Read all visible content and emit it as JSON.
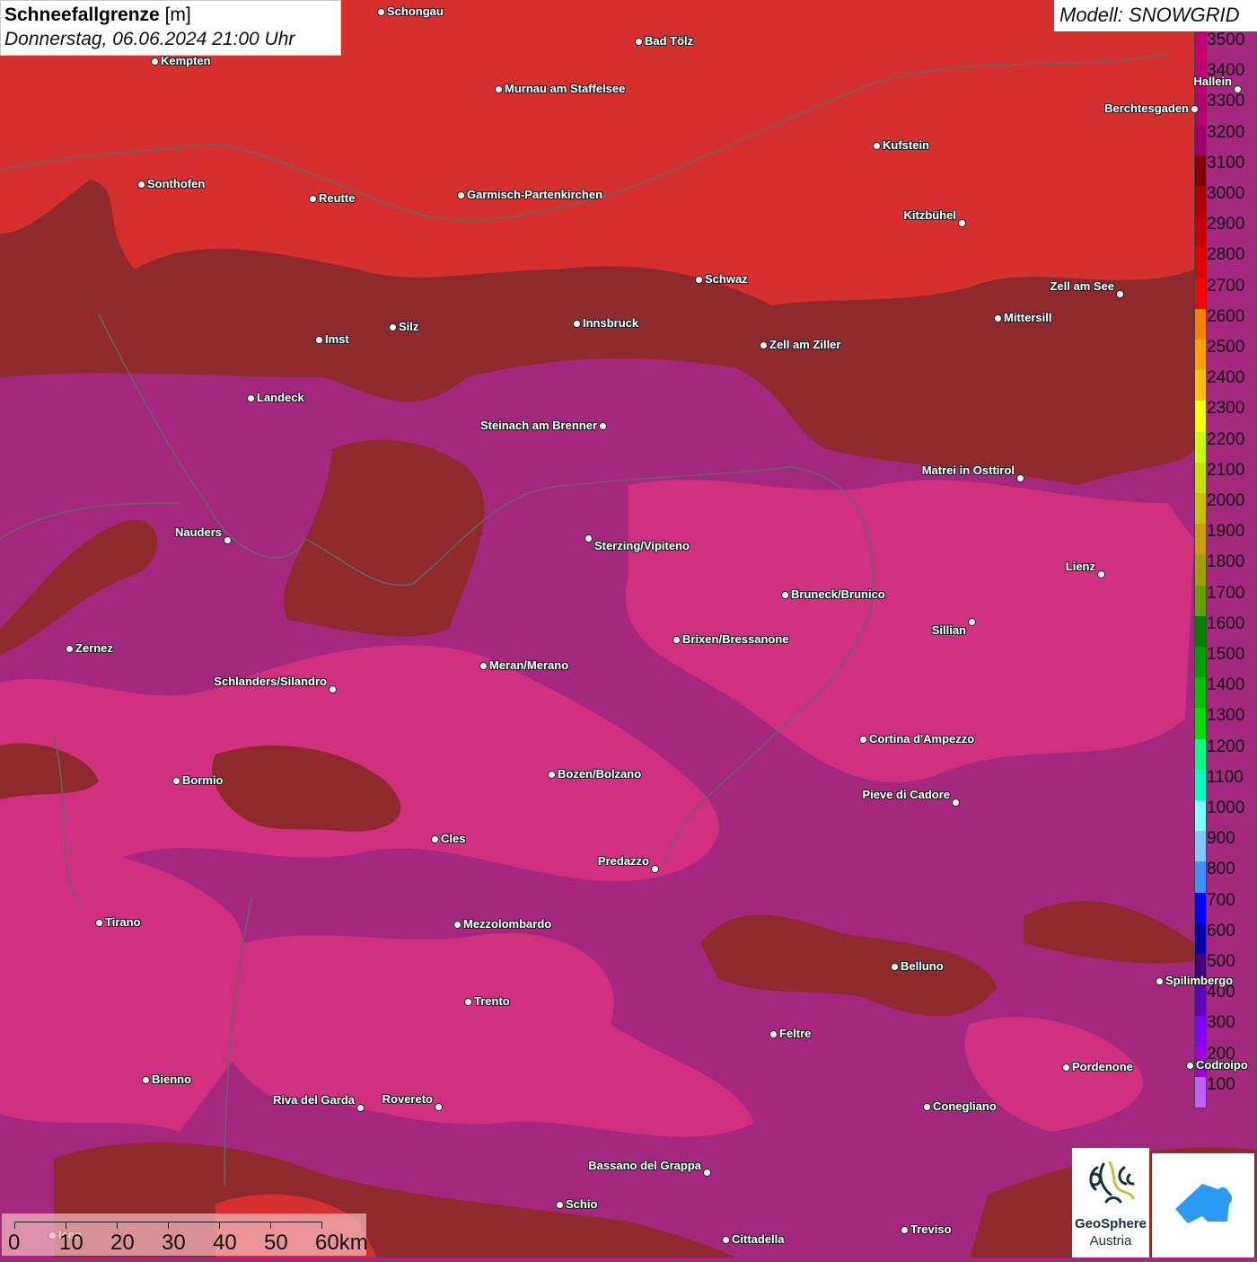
{
  "header": {
    "title": "Schneefallgrenze",
    "unit": "[m]",
    "datetime": "Donnerstag, 06.06.2024 21:00 Uhr",
    "model": "Modell: SNOWGRID"
  },
  "legend": {
    "labels": [
      "3500",
      "3400",
      "3300",
      "3200",
      "3100",
      "3000",
      "2900",
      "2800",
      "2700",
      "2600",
      "2500",
      "2400",
      "2300",
      "2200",
      "2100",
      "2000",
      "1900",
      "1800",
      "1700",
      "1600",
      "1500",
      "1400",
      "1300",
      "1200",
      "1100",
      "1000",
      "900",
      "800",
      "700",
      "600",
      "500",
      "400",
      "300",
      "200",
      "100"
    ],
    "colors": [
      "#c8006e",
      "#c00072",
      "#b4006c",
      "#a0006c",
      "#800000",
      "#b00000",
      "#c80000",
      "#e00000",
      "#ff0000",
      "#ff8000",
      "#ffa000",
      "#ffc000",
      "#ffff00",
      "#c8ff00",
      "#c8e000",
      "#c8c000",
      "#c8a000",
      "#a0a000",
      "#60a000",
      "#008000",
      "#00a000",
      "#00c000",
      "#00e000",
      "#00ff80",
      "#00ffc0",
      "#80ffff",
      "#80c8ff",
      "#4090ff",
      "#0000ff",
      "#0000b0",
      "#400080",
      "#6000c0",
      "#8000ff",
      "#a000e0",
      "#c060ff"
    ]
  },
  "map_colors": {
    "high_red": "#d6302e",
    "dark_red": "#8e2a2c",
    "purple": "#a4287e",
    "magenta": "#d0307e"
  },
  "cities": [
    "Schongau",
    "Bad Tölz",
    "Kempten",
    "Murnau am Staffelsee",
    "Hallein",
    "Berchtesgaden",
    "Kufstein",
    "Sonthofen",
    "Reutte",
    "Garmisch-Partenkirchen",
    "Kitzbühel",
    "Schwaz",
    "Zell am See",
    "Mittersill",
    "Innsbruck",
    "Silz",
    "Imst",
    "Zell am Ziller",
    "Landeck",
    "Steinach am Brenner",
    "Matrei in Osttirol",
    "Nauders",
    "Sterzing/Vipiteno",
    "Lienz",
    "Bruneck/Brunico",
    "Sillian",
    "Zernez",
    "Brixen/Bressanone",
    "Meran/Merano",
    "Schlanders/Silandro",
    "Cortina d'Ampezzo",
    "Bozen/Bolzano",
    "Bormio",
    "Pieve di Cadore",
    "Cles",
    "Predazzo",
    "Tirano",
    "Mezzolombardo",
    "Belluno",
    "Spilimbergo",
    "Trento",
    "Feltre",
    "Pordenone",
    "Codroipo",
    "Bienno",
    "Riva del Garda",
    "Rovereto",
    "Conegliano",
    "Bassano del Grappa",
    "Schio",
    "Treviso",
    "Cittadella",
    "Iseo"
  ],
  "scalebar": {
    "labels": [
      "0",
      "10",
      "20",
      "30",
      "40",
      "50",
      "60km"
    ]
  },
  "logos": {
    "geosphere_line1": "GeoSphere",
    "geosphere_line2": "Austria"
  }
}
